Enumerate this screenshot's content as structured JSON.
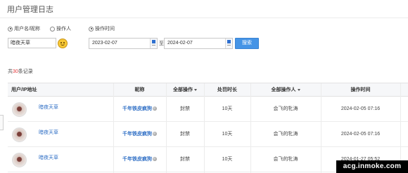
{
  "page": {
    "title": "用户管理日志"
  },
  "filters": {
    "radios": [
      {
        "label": "用户名/昵称",
        "checked": true
      },
      {
        "label": "操作人",
        "checked": false
      },
      {
        "label": "操作时间",
        "checked": true
      }
    ],
    "name_value": "暗夜天草",
    "date_start": "2023-02-07",
    "date_to_label": "至",
    "date_end": "2024-02-07",
    "search_label": "搜索"
  },
  "summary": {
    "prefix": "共",
    "count": "30",
    "suffix": "条记录"
  },
  "table": {
    "headers": {
      "user": "用户/IP地址",
      "nickname": "昵称",
      "operation": "全部操作",
      "duration": "处罚时长",
      "operator": "全部操作人",
      "time": "操作时间"
    },
    "rows": [
      {
        "user": "暗夜天草",
        "nickname": "千年铁皮疯狗",
        "operation": "封禁",
        "duration": "10天",
        "operator": "会飞的牝涛",
        "time": "2024-02-05 07:16"
      },
      {
        "user": "暗夜天草",
        "nickname": "千年铁皮疯狗",
        "operation": "封禁",
        "duration": "10天",
        "operator": "会飞的牝涛",
        "time": "2024-02-05 07:16"
      },
      {
        "user": "暗夜天草",
        "nickname": "千年铁皮疯狗",
        "operation": "封禁",
        "duration": "10天",
        "operator": "会飞的牝涛",
        "time": "2024-01-27 05:52"
      }
    ]
  },
  "watermark": "acg.inmoke.com",
  "colors": {
    "accent": "#4594e6",
    "link": "#2b6cc4",
    "count": "#e4393c",
    "header_bg": "#f6f7f9"
  }
}
